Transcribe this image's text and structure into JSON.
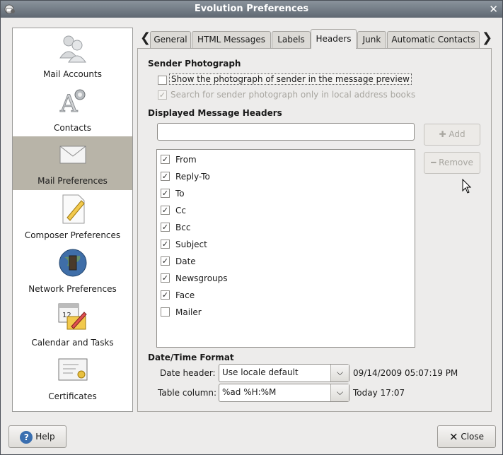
{
  "window": {
    "title": "Evolution Preferences",
    "close_glyph": "✕"
  },
  "sidebar": {
    "items": [
      {
        "label": "Mail Accounts",
        "icon": "mail-accounts-icon"
      },
      {
        "label": "Contacts",
        "icon": "contacts-icon"
      },
      {
        "label": "Mail Preferences",
        "icon": "mail-preferences-icon",
        "selected": true
      },
      {
        "label": "Composer Preferences",
        "icon": "composer-icon"
      },
      {
        "label": "Network Preferences",
        "icon": "network-icon"
      },
      {
        "label": "Calendar and Tasks",
        "icon": "calendar-icon"
      },
      {
        "label": "Certificates",
        "icon": "certificates-icon"
      }
    ]
  },
  "tabs": {
    "items": [
      "General",
      "HTML Messages",
      "Labels",
      "Headers",
      "Junk",
      "Automatic Contacts"
    ],
    "active": "Headers",
    "left_arrow": "❮",
    "right_arrow": "❯"
  },
  "sender_photo": {
    "title": "Sender Photograph",
    "show_label": "Show the photograph of sender in the message preview",
    "show_checked": false,
    "local_label": "Search for sender photograph only in local address books",
    "local_checked": true,
    "local_disabled": true
  },
  "headers": {
    "title": "Displayed Message Headers",
    "entry_value": "",
    "add_label": "Add",
    "remove_label": "Remove",
    "list": [
      {
        "name": "From",
        "checked": true
      },
      {
        "name": "Reply-To",
        "checked": true
      },
      {
        "name": "To",
        "checked": true
      },
      {
        "name": "Cc",
        "checked": true
      },
      {
        "name": "Bcc",
        "checked": true
      },
      {
        "name": "Subject",
        "checked": true
      },
      {
        "name": "Date",
        "checked": true
      },
      {
        "name": "Newsgroups",
        "checked": true
      },
      {
        "name": "Face",
        "checked": true
      },
      {
        "name": "Mailer",
        "checked": false
      }
    ]
  },
  "datetime": {
    "title": "Date/Time Format",
    "date_header_label": "Date header:",
    "date_header_value": "Use locale default",
    "date_header_preview": "09/14/2009 05:07:19 PM",
    "table_column_label": "Table column:",
    "table_column_value": "%ad %H:%M",
    "table_column_preview": "Today 17:07"
  },
  "footer": {
    "help_label": "Help",
    "close_label": "Close"
  },
  "colors": {
    "selected_bg": "#b8b4a8",
    "titlebar": "#6f7882"
  }
}
